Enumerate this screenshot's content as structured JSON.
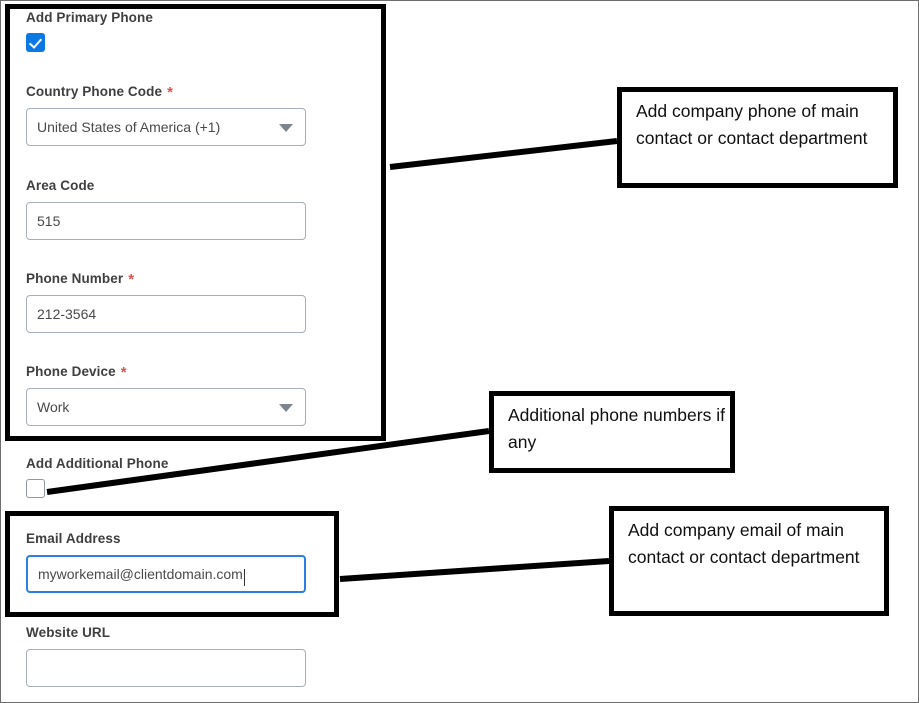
{
  "form": {
    "primary_phone": {
      "section_label": "Add Primary Phone",
      "checkbox_state": "checked",
      "country_phone_code": {
        "label": "Country Phone Code",
        "required_marker": "*",
        "value": "United States of America (+1)"
      },
      "area_code": {
        "label": "Area Code",
        "value": "515"
      },
      "phone_number": {
        "label": "Phone Number",
        "required_marker": "*",
        "value": "212-3564"
      },
      "phone_device": {
        "label": "Phone Device",
        "required_marker": "*",
        "value": "Work"
      }
    },
    "additional_phone": {
      "section_label": "Add Additional Phone",
      "checkbox_state": "unchecked"
    },
    "email_address": {
      "label": "Email Address",
      "value": "myworkemail@clientdomain.com",
      "focused": true
    },
    "website_url": {
      "label": "Website URL",
      "value": ""
    }
  },
  "annotations": {
    "callout_phone": {
      "text": "Add company phone of main contact or contact department"
    },
    "callout_additional_phone": {
      "text": "Additional phone numbers if any"
    },
    "callout_email": {
      "text": "Add company email of main contact or contact department"
    }
  },
  "colors": {
    "checkbox_accent": "#0b78e3",
    "focus_border": "#2a7fe0",
    "required_asterisk": "#d9534f",
    "label_text": "#3f3f3f",
    "annotation_stroke": "#000000"
  }
}
